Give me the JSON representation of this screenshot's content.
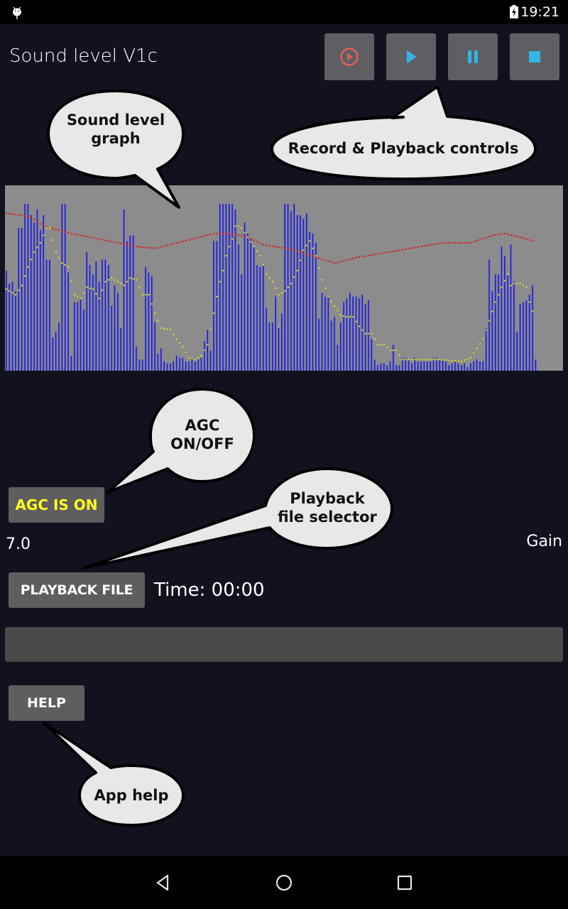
{
  "status_bar": {
    "time": "19:21",
    "left_icon": "android-debug-icon",
    "battery_icon": "battery-charging-icon"
  },
  "app": {
    "title": "Sound level V1c"
  },
  "controls": [
    {
      "name": "record",
      "icon": "record-icon",
      "color": "#e0605a"
    },
    {
      "name": "play",
      "icon": "play-icon",
      "color": "#33b5e5"
    },
    {
      "name": "pause",
      "icon": "pause-icon",
      "color": "#33b5e5"
    },
    {
      "name": "stop",
      "icon": "stop-icon",
      "color": "#33b5e5"
    }
  ],
  "callouts": {
    "graph": [
      "Sound level",
      "graph"
    ],
    "controls": [
      "Record & Playback controls"
    ],
    "agc": [
      "AGC",
      "ON/OFF"
    ],
    "playback": [
      "Playback",
      "file selector"
    ],
    "help": [
      "App help"
    ]
  },
  "agc_button": {
    "label": "AGC IS ON",
    "label_color": "#ffff1f"
  },
  "gain": {
    "value": "7.0",
    "label": "Gain"
  },
  "playback_button": {
    "label": "PLAYBACK FILE"
  },
  "time_label": "Time: 00:00",
  "help_button": {
    "label": "HELP"
  },
  "nav": {
    "back": "back-icon",
    "home": "home-icon",
    "recents": "recents-icon"
  },
  "chart_data": {
    "type": "bar",
    "title": "Sound level graph",
    "xlabel": "",
    "ylabel": "",
    "ylim": [
      0,
      100
    ],
    "grid": false,
    "colors": {
      "background": "#8c8c8c",
      "bars": "#1a1ad6",
      "average_line": "#d42020",
      "peak_dots": "#e6e61e"
    },
    "series": [
      {
        "name": "level",
        "values": [
          54,
          47,
          48,
          43,
          77,
          77,
          90,
          90,
          84,
          80,
          87,
          76,
          84,
          60,
          60,
          18,
          21,
          26,
          90,
          90,
          53,
          8,
          37,
          37,
          39,
          33,
          64,
          57,
          52,
          59,
          48,
          60,
          60,
          57,
          35,
          46,
          42,
          23,
          87,
          70,
          73,
          73,
          13,
          6,
          6,
          56,
          53,
          51,
          26,
          9,
          12,
          5,
          4,
          4,
          5,
          8,
          7,
          7,
          5,
          5,
          7,
          5,
          6,
          7,
          16,
          22,
          11,
          70,
          70,
          90,
          90,
          90,
          90,
          90,
          87,
          68,
          52,
          80,
          74,
          71,
          67,
          57,
          56,
          57,
          34,
          26,
          26,
          40,
          23,
          31,
          90,
          90,
          86,
          90,
          84,
          84,
          82,
          85,
          75,
          74,
          69,
          28,
          42,
          40,
          40,
          27,
          29,
          14,
          26,
          37,
          39,
          42,
          40,
          40,
          39,
          41,
          36,
          38,
          17,
          6,
          3,
          4,
          4,
          3,
          5,
          14,
          3,
          3,
          7,
          7,
          6,
          4,
          7,
          5,
          5,
          5,
          5,
          5,
          7,
          7,
          6,
          6,
          5,
          3,
          4,
          5,
          4,
          3,
          4,
          2,
          4,
          5,
          6,
          5,
          5,
          23,
          60,
          43,
          52,
          52,
          67,
          62,
          52,
          68,
          48,
          21,
          36,
          37,
          38,
          41,
          46,
          6
        ]
      },
      {
        "name": "average",
        "points": [
          [
            0,
            85
          ],
          [
            8,
            83
          ],
          [
            12,
            78
          ],
          [
            21,
            74
          ],
          [
            33,
            70
          ],
          [
            42,
            67
          ],
          [
            48,
            66
          ],
          [
            53,
            68
          ],
          [
            60,
            71
          ],
          [
            67,
            74
          ],
          [
            72,
            74
          ],
          [
            78,
            72
          ],
          [
            83,
            68
          ],
          [
            90,
            66
          ],
          [
            97,
            63
          ],
          [
            106,
            58
          ],
          [
            113,
            61
          ],
          [
            120,
            63
          ],
          [
            127,
            65
          ],
          [
            134,
            67
          ],
          [
            141,
            69
          ],
          [
            150,
            69
          ],
          [
            157,
            73
          ],
          [
            161,
            74
          ],
          [
            166,
            72
          ],
          [
            170,
            70
          ]
        ]
      },
      {
        "name": "peak",
        "points": [
          [
            0,
            44
          ],
          [
            3,
            41
          ],
          [
            5,
            46
          ],
          [
            7,
            56
          ],
          [
            9,
            64
          ],
          [
            11,
            69
          ],
          [
            13,
            77
          ],
          [
            14,
            77
          ],
          [
            16,
            64
          ],
          [
            18,
            58
          ],
          [
            20,
            56
          ],
          [
            22,
            41
          ],
          [
            24,
            39
          ],
          [
            26,
            45
          ],
          [
            28,
            44
          ],
          [
            30,
            39
          ],
          [
            32,
            48
          ],
          [
            34,
            50
          ],
          [
            36,
            48
          ],
          [
            38,
            46
          ],
          [
            40,
            50
          ],
          [
            42,
            49
          ],
          [
            44,
            41
          ],
          [
            46,
            41
          ],
          [
            48,
            31
          ],
          [
            50,
            23
          ],
          [
            53,
            22
          ],
          [
            55,
            17
          ],
          [
            57,
            13
          ],
          [
            59,
            7
          ],
          [
            61,
            6
          ],
          [
            63,
            8
          ],
          [
            65,
            14
          ],
          [
            67,
            31
          ],
          [
            68,
            40
          ],
          [
            69,
            48
          ],
          [
            70,
            54
          ],
          [
            71,
            62
          ],
          [
            72,
            67
          ],
          [
            73,
            71
          ],
          [
            74,
            78
          ],
          [
            75,
            78
          ],
          [
            76,
            77
          ],
          [
            78,
            72
          ],
          [
            80,
            67
          ],
          [
            82,
            62
          ],
          [
            84,
            52
          ],
          [
            86,
            48
          ],
          [
            88,
            41
          ],
          [
            90,
            43
          ],
          [
            92,
            47
          ],
          [
            94,
            54
          ],
          [
            96,
            65
          ],
          [
            98,
            70
          ],
          [
            100,
            62
          ],
          [
            102,
            49
          ],
          [
            104,
            40
          ],
          [
            106,
            35
          ],
          [
            108,
            30
          ],
          [
            110,
            29
          ],
          [
            112,
            29
          ],
          [
            114,
            24
          ],
          [
            116,
            20
          ],
          [
            118,
            20
          ],
          [
            120,
            14
          ],
          [
            122,
            14
          ],
          [
            124,
            11
          ],
          [
            126,
            11
          ],
          [
            128,
            6
          ],
          [
            130,
            6
          ],
          [
            140,
            6
          ],
          [
            147,
            5
          ],
          [
            150,
            7
          ],
          [
            152,
            12
          ],
          [
            154,
            17
          ],
          [
            156,
            27
          ],
          [
            158,
            37
          ],
          [
            160,
            45
          ],
          [
            162,
            52
          ],
          [
            163,
            46
          ],
          [
            164,
            47
          ],
          [
            166,
            47
          ],
          [
            168,
            45
          ],
          [
            169,
            37
          ],
          [
            170,
            32
          ]
        ]
      }
    ]
  }
}
